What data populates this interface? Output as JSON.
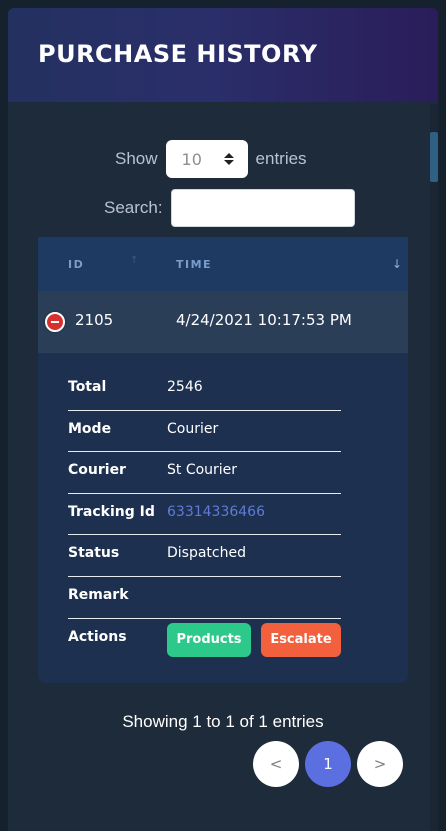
{
  "header": {
    "title": "PURCHASE HISTORY"
  },
  "controls": {
    "show_label": "Show",
    "entries_value": "10",
    "entries_label": "entries",
    "search_label": "Search:",
    "search_value": ""
  },
  "table": {
    "columns": [
      "ID",
      "TIME"
    ],
    "row": {
      "id": "2105",
      "time": "4/24/2021 10:17:53 PM"
    },
    "details": [
      {
        "key": "Total",
        "value": "2546"
      },
      {
        "key": "Mode",
        "value": "Courier"
      },
      {
        "key": "Courier",
        "value": "St Courier"
      },
      {
        "key": "Tracking Id",
        "value": "63314336466"
      },
      {
        "key": "Status",
        "value": "Dispatched"
      },
      {
        "key": "Remark",
        "value": ""
      },
      {
        "key": "Actions",
        "value": ""
      }
    ],
    "actions": {
      "products": "Products",
      "escalate": "Escalate"
    }
  },
  "footer": {
    "info": "Showing 1 to 1 of 1 entries",
    "prev": "<",
    "page": "1",
    "next": ">"
  },
  "colors": {
    "header_bg": "#2a2f6a",
    "products_btn": "#2cc98a",
    "escalate_btn": "#f2603d",
    "active_page": "#5b6fe0",
    "link": "#5f7bd6"
  }
}
